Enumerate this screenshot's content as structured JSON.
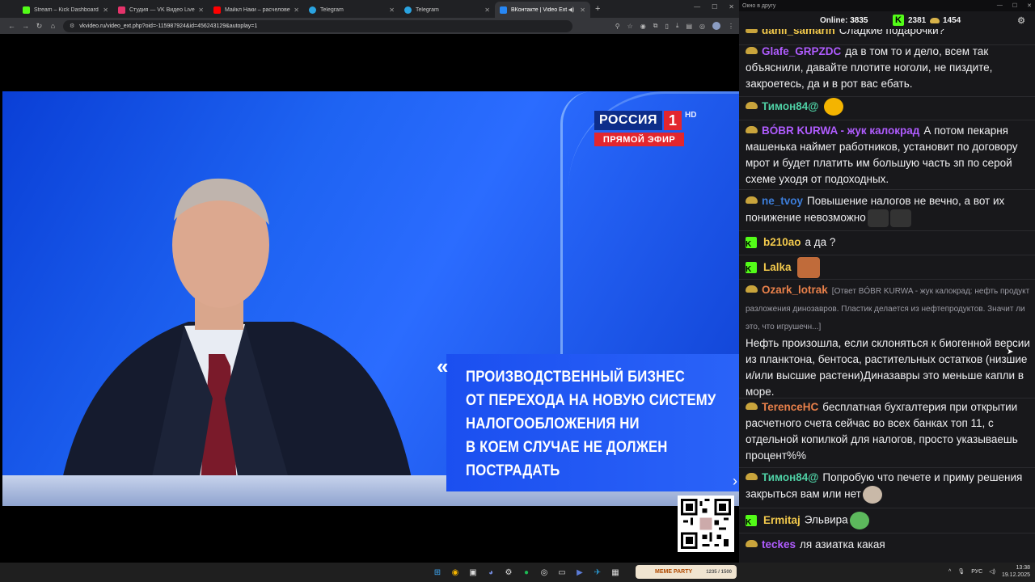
{
  "browser": {
    "tabs": [
      {
        "title": "Stream – Kick Dashboard",
        "favicon_color": "#53fc18",
        "active": false
      },
      {
        "title": "Студия — VK Видео Live",
        "favicon_color": "#e5336b",
        "active": false
      },
      {
        "title": "Майкл Наки – расчеловечив...",
        "favicon_color": "#ff0000",
        "active": false
      },
      {
        "title": "Telegram",
        "favicon_color": "#2aa3e0",
        "active": false
      },
      {
        "title": "Telegram",
        "favicon_color": "#2aa3e0",
        "active": false
      },
      {
        "title": "ВКонтакте | Video Ext",
        "favicon_color": "#2787f5",
        "active": true
      }
    ],
    "url": "vkvideo.ru/video_ext.php?oid=-115987924&id=456243129&autoplay=1"
  },
  "video": {
    "channel_logo": "РОССИЯ",
    "channel_number": "1",
    "hd": "HD",
    "live_label": "ПРЯМОЙ ЭФИР",
    "caption_lines": [
      "ПРОИЗВОДСТВЕННЫЙ БИЗНЕС",
      "ОТ ПЕРЕХОДА НА НОВУЮ СИСТЕМУ",
      "НАЛОГООБЛОЖЕНИЯ НИ",
      "В КОЕМ СЛУЧАЕ НЕ ДОЛЖЕН",
      "ПОСТРАДАТЬ"
    ]
  },
  "chat_window": {
    "title": "Окно в другу",
    "online_label": "Online:",
    "online_count": "3835",
    "kick_count": "2381",
    "points_count": "1454",
    "messages": [
      {
        "user": "danii_samarin",
        "color": "#f2c94c",
        "badge": "coin",
        "text": "Сладкие подарочки?"
      },
      {
        "user": "Glafe_GRPZDC",
        "color": "#b05cff",
        "badge": "coin",
        "text": "да в том то и дело, всем так объяснили, давайте плотите ноголи, не пиздите, закроетесь, да и в рот вас ебать."
      },
      {
        "user": "Тимон84@",
        "color": "#4fd1a5",
        "badge": "coin",
        "text": "",
        "emote_color": "#f4b400"
      },
      {
        "user": "BÓBR KURWA - жук калокрад",
        "color": "#b05cff",
        "badge": "coin",
        "text": "А потом пекарня машенька наймет работников, установит по договору мрот и будет платить им большую часть зп по серой схеме уходя от подоходных."
      },
      {
        "user": "ne_tvoy",
        "color": "#3c7dd9",
        "badge": "coin",
        "text": "Повышение налогов не вечно, а вот их понижение невозможно"
      },
      {
        "user": "b210ao",
        "color": "#f2c94c",
        "badge": "kick",
        "text": "а да ?"
      },
      {
        "user": "Lalka",
        "color": "#f2c94c",
        "badge": "kick",
        "text": "",
        "emote_color": "#c06b3a"
      },
      {
        "user": "Ozark_lotrak",
        "color": "#e8804a",
        "badge": "coin",
        "reply": "[Ответ BÓBR KURWA - жук калокрад: нефть продукт разложения динозавров. Пластик делается из нефтепродуктов. Значит ли это, что игрушечн...]",
        "text": "Нефть произошла, если склоняться к биогенной версии из планктона, бентоса, растительных остатков (низшие и/или высшие растени)Диназавры это меньше капли в море."
      },
      {
        "user": "TerenceHC",
        "color": "#e8804a",
        "badge": "coin",
        "text": "бесплатная бухгалтерия при открытии расчетного счета сейчас во всех банках топ 11, с отдельной копилкой для налогов, просто указываешь процент%%"
      },
      {
        "user": "Тимон84@",
        "color": "#4fd1a5",
        "badge": "coin",
        "text": "Попробую что печете и приму решения закрыться вам или нет"
      },
      {
        "user": "Ermitaj",
        "color": "#f2c94c",
        "badge": "kick",
        "text": "Эльвира"
      },
      {
        "user": "teckes",
        "color": "#b05cff",
        "badge": "coin",
        "text": "ля азиатка какая"
      }
    ]
  },
  "taskbar": {
    "meme_label": "MEME PARTY",
    "meme_value": "1235 / 1500",
    "lang": "РУС",
    "time": "13:38",
    "date": "19.12.2025"
  }
}
